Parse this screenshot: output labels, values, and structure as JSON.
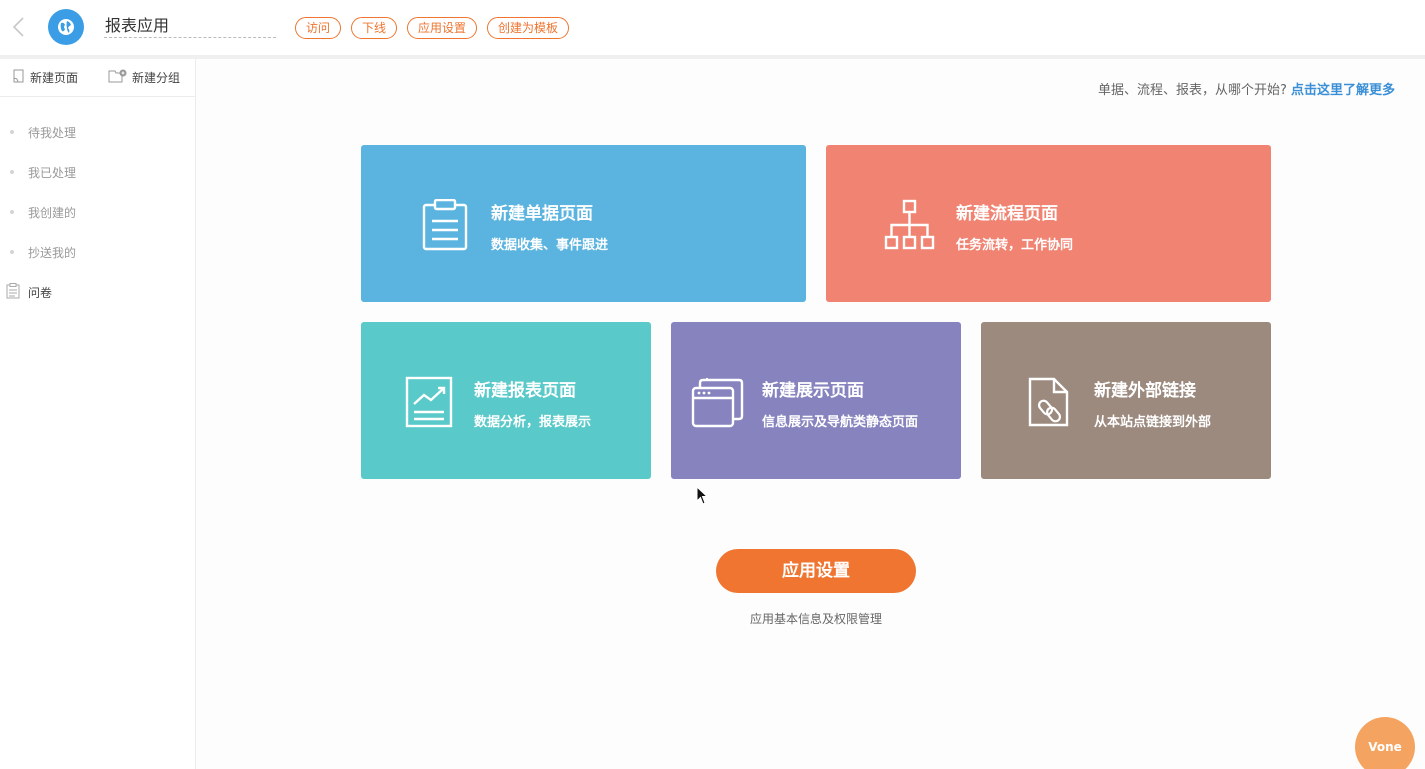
{
  "header": {
    "app_name": "报表应用",
    "buttons": {
      "visit": "访问",
      "offline": "下线",
      "app_settings": "应用设置",
      "create_template": "创建为模板"
    }
  },
  "sidebar": {
    "new_page": "新建页面",
    "new_group": "新建分组",
    "items": [
      {
        "label": "待我处理"
      },
      {
        "label": "我已处理"
      },
      {
        "label": "我创建的"
      },
      {
        "label": "抄送我的"
      },
      {
        "label": "问卷"
      }
    ]
  },
  "main": {
    "hint_text": "单据、流程、报表，从哪个开始?",
    "hint_link": "点击这里了解更多",
    "cards": {
      "form": {
        "title": "新建单据页面",
        "sub": "数据收集、事件跟进",
        "color": "#5ab4df",
        "icon": "clipboard-icon"
      },
      "flow": {
        "title": "新建流程页面",
        "sub": "任务流转，工作协同",
        "color": "#f08372",
        "icon": "org-chart-icon"
      },
      "report": {
        "title": "新建报表页面",
        "sub": "数据分析，报表展示",
        "color": "#5ac9c9",
        "icon": "chart-icon"
      },
      "display": {
        "title": "新建展示页面",
        "sub": "信息展示及导航类静态页面",
        "color": "#8683bf",
        "icon": "windows-icon"
      },
      "link": {
        "title": "新建外部链接",
        "sub": "从本站点链接到外部",
        "color": "#9c8a7e",
        "icon": "file-link-icon"
      }
    },
    "settings_button": "应用设置",
    "settings_desc": "应用基本信息及权限管理"
  },
  "chat_bubble": "Vone",
  "colors": {
    "accent": "#ef7530",
    "logo": "#3a9de6",
    "link": "#3a8fd6"
  }
}
